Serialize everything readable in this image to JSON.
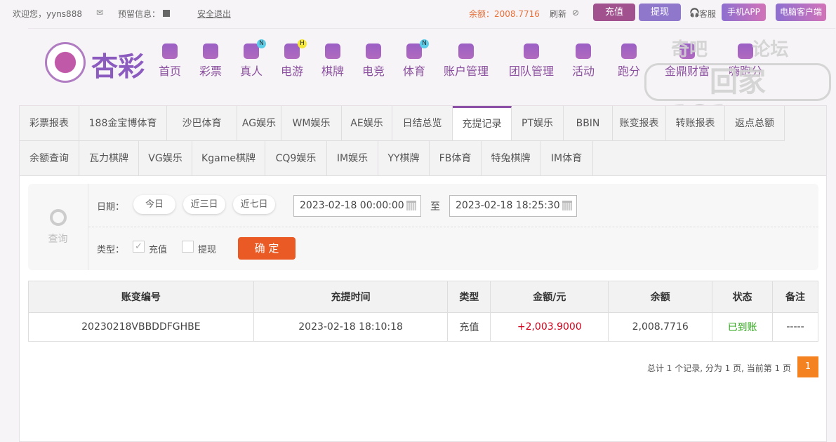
{
  "topbar": {
    "welcome": "欢迎您，yyns888",
    "reserved": "预留信息：",
    "logout": "安全退出",
    "balance": "余额：2008.7716",
    "refresh": "刷新",
    "deposit": "充值",
    "withdraw": "提现",
    "service": "客服",
    "app": "手机APP",
    "pc": "电脑客户端"
  },
  "logo": "杏彩",
  "nav": [
    {
      "label": "首页"
    },
    {
      "label": "彩票"
    },
    {
      "label": "真人",
      "badge": "N"
    },
    {
      "label": "电游",
      "badge": "H"
    },
    {
      "label": "棋牌"
    },
    {
      "label": "电竞"
    },
    {
      "label": "体育",
      "badge": "N"
    },
    {
      "label": "账户管理"
    },
    {
      "label": "团队管理"
    },
    {
      "label": "活动"
    },
    {
      "label": "跑分"
    },
    {
      "label": "金鼎财富"
    },
    {
      "label": "嗨跑分"
    }
  ],
  "watermark": "奇吧 论坛 回家101.com",
  "tabs_row1": [
    "彩票报表",
    "188金宝博体育",
    "沙巴体育",
    "AG娱乐",
    "WM娱乐",
    "AE娱乐",
    "日结总览",
    "充提记录",
    "PT娱乐",
    "BBIN",
    "账变报表",
    "转账报表",
    "返点总额"
  ],
  "tabs_row2": [
    "余额查询",
    "瓦力棋牌",
    "VG娱乐",
    "Kgame棋牌",
    "CQ9娱乐",
    "IM娱乐",
    "YY棋牌",
    "FB体育",
    "特兔棋牌",
    "IM体育"
  ],
  "filter": {
    "search_label": "查询",
    "date_label": "日期：",
    "today": "今日",
    "three_days": "近三日",
    "seven_days": "近七日",
    "start": "2023-02-18 00:00:00",
    "to": "至",
    "end": "2023-02-18 18:25:30",
    "type_label": "类型：",
    "type_deposit": "充值",
    "type_withdraw": "提现",
    "confirm": "确 定"
  },
  "table": {
    "headers": [
      "账变编号",
      "充提时间",
      "类型",
      "金额/元",
      "余额",
      "状态",
      "备注"
    ],
    "rows": [
      [
        "20230218VBBDDFGHBE",
        "2023-02-18 18:10:18",
        "充值",
        "+2,003.9000",
        "2,008.7716",
        "已到账",
        "-----"
      ]
    ]
  },
  "pagination": {
    "summary": "总计 1 个记录, 分为 1 页, 当前第 1 页",
    "page": "1"
  }
}
